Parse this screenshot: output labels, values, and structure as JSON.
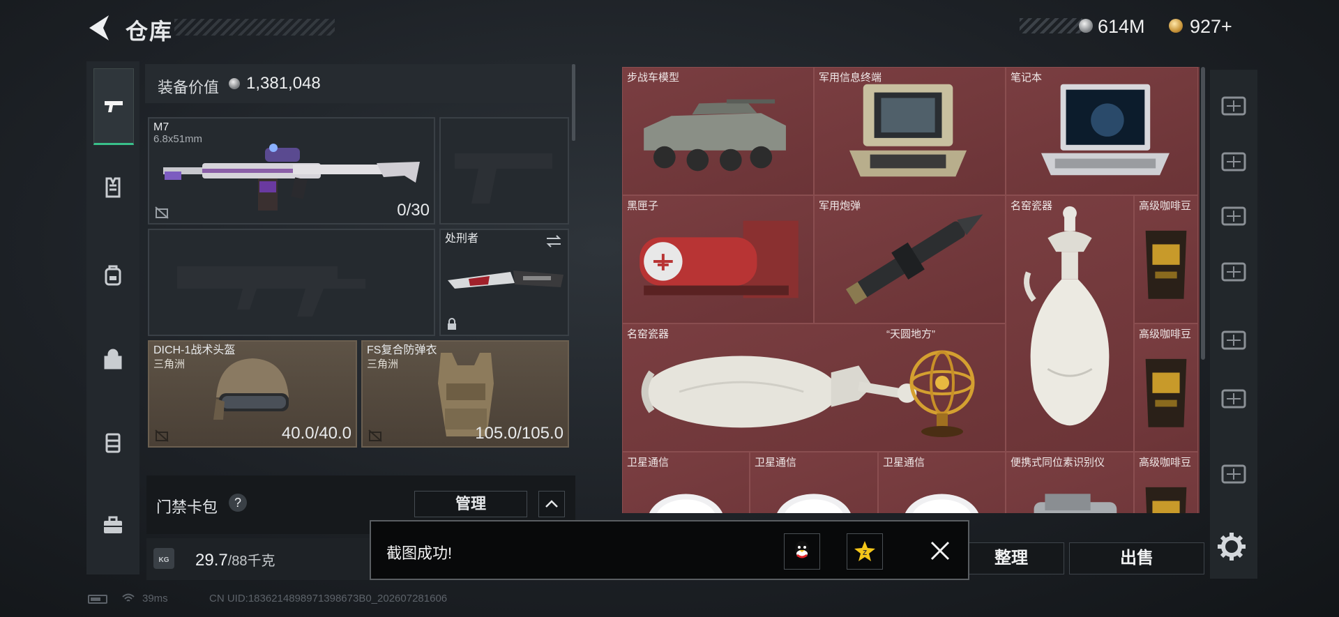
{
  "header": {
    "title": "仓库",
    "back_icon": "back-arrow-icon"
  },
  "currency": {
    "silver": "614M",
    "gold": "927+"
  },
  "rail": [
    {
      "icon": "pistol-icon",
      "active": true
    },
    {
      "icon": "vest-icon",
      "active": false
    },
    {
      "icon": "backpack-icon",
      "active": false
    },
    {
      "icon": "bag-icon",
      "active": false
    },
    {
      "icon": "container-icon",
      "active": false
    },
    {
      "icon": "toolbox-icon",
      "active": false
    }
  ],
  "equipment": {
    "label": "装备价值",
    "value": "1,381,048",
    "primary": {
      "name": "M7",
      "caliber": "6.8x51mm",
      "ammo": "0/30"
    },
    "melee": {
      "name": "处刑者"
    },
    "helmet": {
      "name": "DICH-1战术头盔",
      "origin": "三角洲",
      "durability": "40.0/40.0"
    },
    "armor": {
      "name": "FS复合防弹衣",
      "origin": "三角洲",
      "durability": "105.0/105.0"
    }
  },
  "cardpack": {
    "label": "门禁卡包",
    "help": "?",
    "manage": "管理"
  },
  "weight": {
    "current": "29.7",
    "max": "/88千克",
    "icon": "KG"
  },
  "warehouse": {
    "items": [
      {
        "label": "步战车模型",
        "art": "ifv"
      },
      {
        "label": "军用信息终端",
        "art": "terminal"
      },
      {
        "label": "笔记本",
        "art": "laptop"
      },
      {
        "label": "黑匣子",
        "art": "blackbox"
      },
      {
        "label": "军用炮弹",
        "art": "shell"
      },
      {
        "label": "名窑瓷器",
        "art": "vase-tall"
      },
      {
        "label": "高级咖啡豆",
        "art": "coffee"
      },
      {
        "label": "名窑瓷器",
        "art": "vase-flat"
      },
      {
        "label": "“天圆地方”",
        "art": "globe"
      },
      {
        "label": "高级咖啡豆",
        "art": "coffee"
      },
      {
        "label": "卫星通信",
        "art": "dish"
      },
      {
        "label": "卫星通信",
        "art": "dish"
      },
      {
        "label": "卫星通信",
        "art": "dish"
      },
      {
        "label": "便携式同位素识别仪",
        "art": "scanner"
      },
      {
        "label": "高级咖啡豆",
        "art": "coffee"
      }
    ]
  },
  "actions": {
    "sort": "整理",
    "sell": "出售"
  },
  "right_rail": [
    "category-1-icon",
    "category-2-icon",
    "category-3-icon",
    "category-4-icon",
    "category-5-icon",
    "category-6-icon",
    "category-7-icon"
  ],
  "toast": {
    "message": "截图成功!"
  },
  "status": {
    "ping": "39ms",
    "uid": "CN UID:1836214898971398673B0_202607281606"
  }
}
